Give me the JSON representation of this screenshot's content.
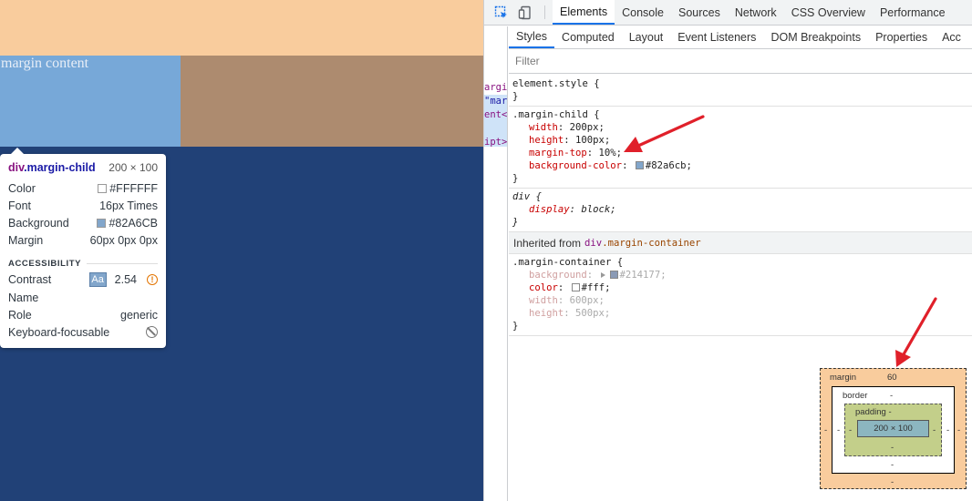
{
  "viewport": {
    "content_text": "margin content"
  },
  "tooltip": {
    "tag": "div",
    "class_name": ".margin-child",
    "size": "200 × 100",
    "rows": [
      {
        "label": "Color",
        "value": "#FFFFFF",
        "swatch": "#ffffff"
      },
      {
        "label": "Font",
        "value": "16px Times"
      },
      {
        "label": "Background",
        "value": "#82A6CB",
        "swatch": "#82a6cb"
      },
      {
        "label": "Margin",
        "value": "60px 0px 0px"
      }
    ],
    "accessibility_heading": "ACCESSIBILITY",
    "contrast_label": "Contrast",
    "contrast_badge": "Aa",
    "contrast_value": "2.54",
    "name_label": "Name",
    "role_label": "Role",
    "role_value": "generic",
    "keyboard_label": "Keyboard-focusable"
  },
  "devtools": {
    "main_tabs": [
      "Elements",
      "Console",
      "Sources",
      "Network",
      "CSS Overview",
      "Performance"
    ],
    "sub_tabs": [
      "Styles",
      "Computed",
      "Layout",
      "Event Listeners",
      "DOM Breakpoints",
      "Properties",
      "Acc"
    ],
    "filter_placeholder": "Filter",
    "dom_strip": [
      "argi",
      "\"mar",
      "ent<",
      "ipt>"
    ],
    "element_style": {
      "selector": "element.style {",
      "close": "}"
    },
    "margin_child_rule": {
      "selector": ".margin-child {",
      "declarations": [
        {
          "prop": "width",
          "value": "200px;"
        },
        {
          "prop": "height",
          "value": "100px;"
        },
        {
          "prop": "margin-top",
          "value": "10%;"
        },
        {
          "prop": "background-color",
          "value": "#82a6cb;",
          "swatch": "#82a6cb"
        }
      ],
      "close": "}"
    },
    "div_rule": {
      "selector": "div {",
      "declarations": [
        {
          "prop": "display",
          "value": "block;"
        }
      ],
      "close": "}"
    },
    "inherited": {
      "label": "Inherited from",
      "tag": "div",
      "class_name": ".margin-container"
    },
    "margin_container_rule": {
      "selector": ".margin-container {",
      "declarations": [
        {
          "prop": "background",
          "value": "#214177;",
          "swatch": "#214177"
        },
        {
          "prop": "color",
          "value": "#fff;",
          "swatch": "#ffffff"
        },
        {
          "prop": "width",
          "value": "600px;"
        },
        {
          "prop": "height",
          "value": "500px;"
        }
      ],
      "close": "}"
    },
    "box_model": {
      "margin_label": "margin",
      "margin_top": "60",
      "margin_right": "-",
      "margin_bottom": "-",
      "margin_left": "-",
      "border_label": "border",
      "border_top": "-",
      "border_right": "-",
      "border_bottom": "-",
      "border_left": "-",
      "padding_label": "padding -",
      "padding_right": "-",
      "padding_bottom": "-",
      "padding_left": "-",
      "content": "200 × 100"
    }
  },
  "colors": {
    "margin_highlight": "#f9cc9d",
    "content_highlight": "#77a8d8",
    "container_bg": "#214177",
    "annotation_arrow": "#e0202a",
    "active_tab": "#1a73e8"
  }
}
